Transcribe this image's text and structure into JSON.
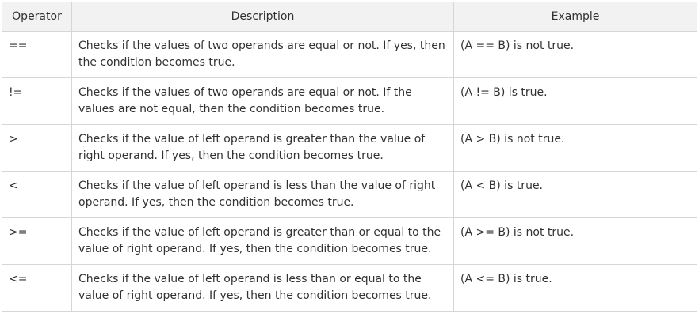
{
  "table": {
    "headers": [
      "Operator",
      "Description",
      "Example"
    ],
    "rows": [
      {
        "operator": "==",
        "description": "Checks if the values of two operands are equal or not. If yes, then the condition becomes true.",
        "example": "(A == B) is not true."
      },
      {
        "operator": "!=",
        "description": "Checks if the values of two operands are equal or not. If the values are not equal, then the condition becomes true.",
        "example": "(A != B) is true."
      },
      {
        "operator": ">",
        "description": "Checks if the value of left operand is greater than the value of right operand. If yes, then the condition becomes true.",
        "example": "(A > B) is not true."
      },
      {
        "operator": "<",
        "description": "Checks if the value of left operand is less than the value of right operand. If yes, then the condition becomes true.",
        "example": "(A < B) is true."
      },
      {
        "operator": ">=",
        "description": "Checks if the value of left operand is greater than or equal to the value of right operand. If yes, then the condition becomes true.",
        "example": "(A >= B) is not true."
      },
      {
        "operator": "<=",
        "description": "Checks if the value of left operand is less than or equal to the value of right operand. If yes, then the condition becomes true.",
        "example": "(A <= B) is true."
      }
    ]
  }
}
